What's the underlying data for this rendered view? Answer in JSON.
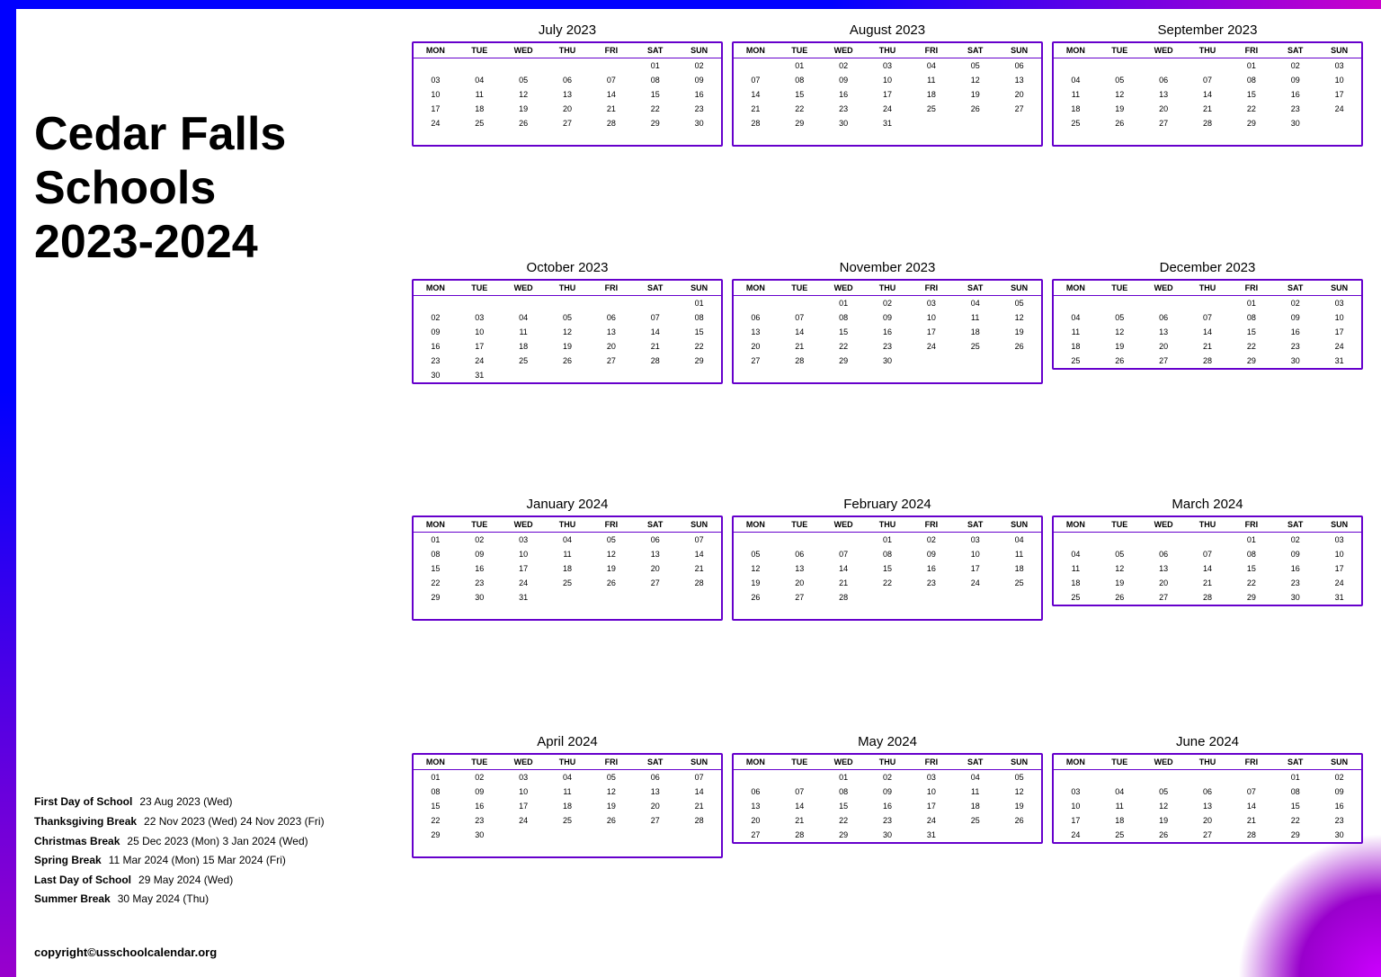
{
  "title": "Cedar Falls Schools 2023-2024",
  "title_line1": "Cedar Falls",
  "title_line2": "Schools",
  "title_line3": "2023-2024",
  "copyright": "copyright©usschoolcalendar.org",
  "info": [
    {
      "label": "First Day of School",
      "value": "23 Aug 2023 (Wed)"
    },
    {
      "label": "Thanksgiving Break",
      "value": "22 Nov 2023 (Wed) 24 Nov 2023 (Fri)"
    },
    {
      "label": "Christmas Break",
      "value": "25 Dec 2023 (Mon) 3 Jan 2024 (Wed)"
    },
    {
      "label": "Spring Break",
      "value": "11 Mar 2024 (Mon) 15 Mar 2024 (Fri)"
    },
    {
      "label": "Last Day of School",
      "value": "29 May 2024 (Wed)"
    },
    {
      "label": "Summer Break",
      "value": "30 May 2024 (Thu)"
    }
  ],
  "months": [
    {
      "name": "July 2023",
      "days": [
        "",
        "",
        "",
        "",
        "",
        "01",
        "02",
        "03",
        "04",
        "05",
        "06",
        "07",
        "08",
        "09",
        "10",
        "11",
        "12",
        "13",
        "14",
        "15",
        "16",
        "17",
        "18",
        "19",
        "20",
        "21",
        "22",
        "23",
        "24",
        "25",
        "26",
        "27",
        "28",
        "29",
        "30",
        "",
        ""
      ]
    },
    {
      "name": "August 2023",
      "days": [
        "",
        "01",
        "02",
        "03",
        "04",
        "05",
        "06",
        "07",
        "08",
        "09",
        "10",
        "11",
        "12",
        "13",
        "14",
        "15",
        "16",
        "17",
        "18",
        "19",
        "20",
        "21",
        "22",
        "23",
        "24",
        "25",
        "26",
        "27",
        "28",
        "29",
        "30",
        "31",
        "",
        "",
        "",
        ""
      ]
    },
    {
      "name": "September 2023",
      "days": [
        "",
        "",
        "",
        "",
        "01",
        "02",
        "03",
        "04",
        "05",
        "06",
        "07",
        "08",
        "09",
        "10",
        "11",
        "12",
        "13",
        "14",
        "15",
        "16",
        "17",
        "18",
        "19",
        "20",
        "21",
        "22",
        "23",
        "24",
        "25",
        "26",
        "27",
        "28",
        "29",
        "30",
        "",
        ""
      ]
    },
    {
      "name": "October 2023",
      "days": [
        "",
        "",
        "",
        "",
        "",
        "",
        "01",
        "02",
        "03",
        "04",
        "05",
        "06",
        "07",
        "08",
        "09",
        "10",
        "11",
        "12",
        "13",
        "14",
        "15",
        "16",
        "17",
        "18",
        "19",
        "20",
        "21",
        "22",
        "23",
        "24",
        "25",
        "26",
        "27",
        "28",
        "29",
        "30",
        "31",
        ""
      ]
    },
    {
      "name": "November 2023",
      "days": [
        "",
        "",
        "01",
        "02",
        "03",
        "04",
        "05",
        "06",
        "07",
        "08",
        "09",
        "10",
        "11",
        "12",
        "13",
        "14",
        "15",
        "16",
        "17",
        "18",
        "19",
        "20",
        "21",
        "22",
        "23",
        "24",
        "25",
        "26",
        "27",
        "28",
        "29",
        "30",
        "",
        "",
        "",
        ""
      ]
    },
    {
      "name": "December 2023",
      "days": [
        "",
        "",
        "",
        "",
        "01",
        "02",
        "03",
        "04",
        "05",
        "06",
        "07",
        "08",
        "09",
        "10",
        "11",
        "12",
        "13",
        "14",
        "15",
        "16",
        "17",
        "18",
        "19",
        "20",
        "21",
        "22",
        "23",
        "24",
        "25",
        "26",
        "27",
        "28",
        "29",
        "30",
        "31"
      ]
    },
    {
      "name": "January 2024",
      "days": [
        "01",
        "02",
        "03",
        "04",
        "05",
        "06",
        "07",
        "08",
        "09",
        "10",
        "11",
        "12",
        "13",
        "14",
        "15",
        "16",
        "17",
        "18",
        "19",
        "20",
        "21",
        "22",
        "23",
        "24",
        "25",
        "26",
        "27",
        "28",
        "29",
        "30",
        "31",
        "",
        "",
        "",
        "",
        ""
      ]
    },
    {
      "name": "February 2024",
      "days": [
        "",
        "",
        "",
        "01",
        "02",
        "03",
        "04",
        "05",
        "06",
        "07",
        "08",
        "09",
        "10",
        "11",
        "12",
        "13",
        "14",
        "15",
        "16",
        "17",
        "18",
        "19",
        "20",
        "21",
        "22",
        "23",
        "24",
        "25",
        "26",
        "27",
        "28",
        "",
        "",
        "",
        "",
        ""
      ]
    },
    {
      "name": "March 2024",
      "days": [
        "",
        "",
        "",
        "",
        "01",
        "02",
        "03",
        "04",
        "05",
        "06",
        "07",
        "08",
        "09",
        "10",
        "11",
        "12",
        "13",
        "14",
        "15",
        "16",
        "17",
        "18",
        "19",
        "20",
        "21",
        "22",
        "23",
        "24",
        "25",
        "26",
        "27",
        "28",
        "29",
        "30",
        "31"
      ]
    },
    {
      "name": "April 2024",
      "days": [
        "01",
        "02",
        "03",
        "04",
        "05",
        "06",
        "07",
        "08",
        "09",
        "10",
        "11",
        "12",
        "13",
        "14",
        "15",
        "16",
        "17",
        "18",
        "19",
        "20",
        "21",
        "22",
        "23",
        "24",
        "25",
        "26",
        "27",
        "28",
        "29",
        "30",
        "",
        "",
        "",
        "",
        "",
        ""
      ]
    },
    {
      "name": "May 2024",
      "days": [
        "",
        "",
        "01",
        "02",
        "03",
        "04",
        "05",
        "06",
        "07",
        "08",
        "09",
        "10",
        "11",
        "12",
        "13",
        "14",
        "15",
        "16",
        "17",
        "18",
        "19",
        "20",
        "21",
        "22",
        "23",
        "24",
        "25",
        "26",
        "27",
        "28",
        "29",
        "30",
        "31",
        "",
        ""
      ]
    },
    {
      "name": "June 2024",
      "days": [
        "",
        "",
        "",
        "",
        "",
        "01",
        "02",
        "03",
        "04",
        "05",
        "06",
        "07",
        "08",
        "09",
        "10",
        "11",
        "12",
        "13",
        "14",
        "15",
        "16",
        "17",
        "18",
        "19",
        "20",
        "21",
        "22",
        "23",
        "24",
        "25",
        "26",
        "27",
        "28",
        "29",
        "30"
      ]
    }
  ],
  "day_headers": [
    "MON",
    "TUE",
    "WED",
    "THU",
    "FRI",
    "SAT",
    "SUN"
  ]
}
